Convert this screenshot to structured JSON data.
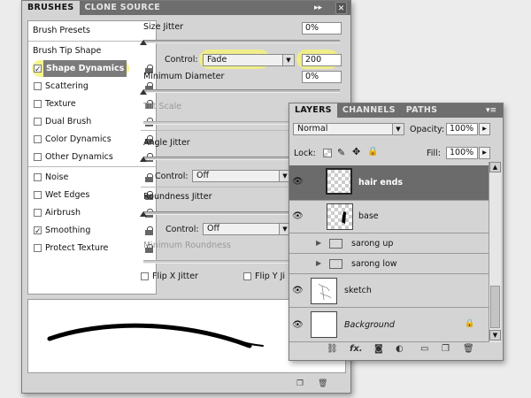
{
  "brushes_panel": {
    "tabs": [
      "BRUSHES",
      "CLONE SOURCE"
    ],
    "menu_glyph": "▸▸",
    "close_glyph": "✕",
    "list": [
      {
        "label": "Brush Presets",
        "checkbox": false,
        "checked": false,
        "lock": false
      },
      {
        "label": "Brush Tip Shape",
        "checkbox": false,
        "checked": false,
        "lock": false
      },
      {
        "label": "Shape Dynamics",
        "checkbox": true,
        "checked": true,
        "lock": true
      },
      {
        "label": "Scattering",
        "checkbox": true,
        "checked": false,
        "lock": true
      },
      {
        "label": "Texture",
        "checkbox": true,
        "checked": false,
        "lock": true
      },
      {
        "label": "Dual Brush",
        "checkbox": true,
        "checked": false,
        "lock": true
      },
      {
        "label": "Color Dynamics",
        "checkbox": true,
        "checked": false,
        "lock": true
      },
      {
        "label": "Other Dynamics",
        "checkbox": true,
        "checked": false,
        "lock": true
      },
      {
        "label": "Noise",
        "checkbox": true,
        "checked": false,
        "lock": true
      },
      {
        "label": "Wet Edges",
        "checkbox": true,
        "checked": false,
        "lock": true
      },
      {
        "label": "Airbrush",
        "checkbox": true,
        "checked": false,
        "lock": true
      },
      {
        "label": "Smoothing",
        "checkbox": true,
        "checked": true,
        "lock": true
      },
      {
        "label": "Protect Texture",
        "checkbox": true,
        "checked": false,
        "lock": true
      }
    ],
    "size_jitter": {
      "label": "Size Jitter",
      "value": "0%",
      "slider_fraction": 0.0
    },
    "size_control": {
      "label": "Control:",
      "value": "Fade",
      "steps": "200"
    },
    "min_diameter": {
      "label": "Minimum Diameter",
      "value": "0%",
      "slider_fraction": 0.0
    },
    "tilt_scale": {
      "label": "Tilt Scale"
    },
    "angle_jitter": {
      "label": "Angle Jitter",
      "slider_fraction": 0.0
    },
    "angle_control": {
      "label": "Control:",
      "value": "Off"
    },
    "roundness_jitter": {
      "label": "Roundness Jitter",
      "slider_fraction": 0.0
    },
    "roundness_control": {
      "label": "Control:",
      "value": "Off"
    },
    "min_roundness": {
      "label": "Minimum Roundness"
    },
    "flip_x": {
      "label": "Flip X Jitter",
      "checked": false
    },
    "flip_y": {
      "label": "Flip Y Ji",
      "checked": false
    }
  },
  "layers_panel": {
    "tabs": [
      "LAYERS",
      "CHANNELS",
      "PATHS"
    ],
    "blend_mode": "Normal",
    "opacity": {
      "label": "Opacity:",
      "value": "100%"
    },
    "lock": {
      "label": "Lock:"
    },
    "fill": {
      "label": "Fill:",
      "value": "100%"
    },
    "layers": [
      {
        "name": "hair ends",
        "type": "layer",
        "selected": true,
        "italic": false
      },
      {
        "name": "base",
        "type": "layer",
        "selected": false,
        "italic": false
      },
      {
        "name": "sarong up",
        "type": "group",
        "selected": false,
        "italic": false
      },
      {
        "name": "sarong low",
        "type": "group",
        "selected": false,
        "italic": false
      },
      {
        "name": "sketch",
        "type": "layer",
        "selected": false,
        "italic": false
      },
      {
        "name": "Background",
        "type": "background",
        "selected": false,
        "italic": true
      }
    ],
    "footer_icons": [
      "link-icon",
      "fx-icon",
      "mask-icon",
      "adjustment-icon",
      "group-icon",
      "new-layer-icon",
      "trash-icon"
    ]
  },
  "colors": {
    "highlight": "#f3f27a",
    "selected_layer": "#6b6b6b",
    "panel": "#d4d4d4"
  }
}
